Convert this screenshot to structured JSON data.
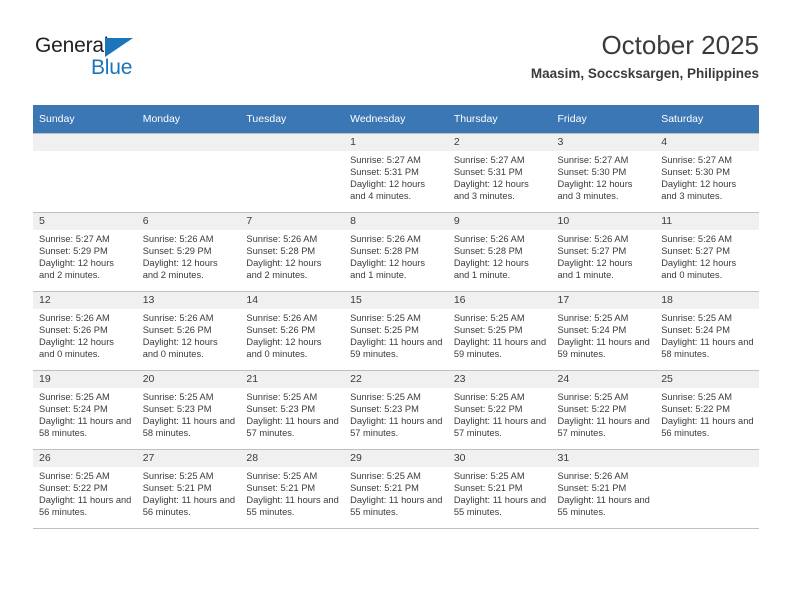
{
  "logo": {
    "word_top": "General",
    "word_bottom": "Blue",
    "triangle_icon": "triangle-icon",
    "accent_color": "#1b75bb"
  },
  "header": {
    "title": "October 2025",
    "subtitle": "Maasim, Soccsksargen, Philippines"
  },
  "theme": {
    "header_row_color": "#3b77b5",
    "daynum_bg": "#f0f0f0",
    "grid_line": "#bfbfbf",
    "text_color": "#3b3b3b"
  },
  "weekdays": [
    "Sunday",
    "Monday",
    "Tuesday",
    "Wednesday",
    "Thursday",
    "Friday",
    "Saturday"
  ],
  "weeks": [
    [
      {
        "day": "",
        "empty": true
      },
      {
        "day": "",
        "empty": true
      },
      {
        "day": "",
        "empty": true
      },
      {
        "day": "1",
        "sunrise": "Sunrise: 5:27 AM",
        "sunset": "Sunset: 5:31 PM",
        "daylight": "Daylight: 12 hours and 4 minutes."
      },
      {
        "day": "2",
        "sunrise": "Sunrise: 5:27 AM",
        "sunset": "Sunset: 5:31 PM",
        "daylight": "Daylight: 12 hours and 3 minutes."
      },
      {
        "day": "3",
        "sunrise": "Sunrise: 5:27 AM",
        "sunset": "Sunset: 5:30 PM",
        "daylight": "Daylight: 12 hours and 3 minutes."
      },
      {
        "day": "4",
        "sunrise": "Sunrise: 5:27 AM",
        "sunset": "Sunset: 5:30 PM",
        "daylight": "Daylight: 12 hours and 3 minutes."
      }
    ],
    [
      {
        "day": "5",
        "sunrise": "Sunrise: 5:27 AM",
        "sunset": "Sunset: 5:29 PM",
        "daylight": "Daylight: 12 hours and 2 minutes."
      },
      {
        "day": "6",
        "sunrise": "Sunrise: 5:26 AM",
        "sunset": "Sunset: 5:29 PM",
        "daylight": "Daylight: 12 hours and 2 minutes."
      },
      {
        "day": "7",
        "sunrise": "Sunrise: 5:26 AM",
        "sunset": "Sunset: 5:28 PM",
        "daylight": "Daylight: 12 hours and 2 minutes."
      },
      {
        "day": "8",
        "sunrise": "Sunrise: 5:26 AM",
        "sunset": "Sunset: 5:28 PM",
        "daylight": "Daylight: 12 hours and 1 minute."
      },
      {
        "day": "9",
        "sunrise": "Sunrise: 5:26 AM",
        "sunset": "Sunset: 5:28 PM",
        "daylight": "Daylight: 12 hours and 1 minute."
      },
      {
        "day": "10",
        "sunrise": "Sunrise: 5:26 AM",
        "sunset": "Sunset: 5:27 PM",
        "daylight": "Daylight: 12 hours and 1 minute."
      },
      {
        "day": "11",
        "sunrise": "Sunrise: 5:26 AM",
        "sunset": "Sunset: 5:27 PM",
        "daylight": "Daylight: 12 hours and 0 minutes."
      }
    ],
    [
      {
        "day": "12",
        "sunrise": "Sunrise: 5:26 AM",
        "sunset": "Sunset: 5:26 PM",
        "daylight": "Daylight: 12 hours and 0 minutes."
      },
      {
        "day": "13",
        "sunrise": "Sunrise: 5:26 AM",
        "sunset": "Sunset: 5:26 PM",
        "daylight": "Daylight: 12 hours and 0 minutes."
      },
      {
        "day": "14",
        "sunrise": "Sunrise: 5:26 AM",
        "sunset": "Sunset: 5:26 PM",
        "daylight": "Daylight: 12 hours and 0 minutes."
      },
      {
        "day": "15",
        "sunrise": "Sunrise: 5:25 AM",
        "sunset": "Sunset: 5:25 PM",
        "daylight": "Daylight: 11 hours and 59 minutes."
      },
      {
        "day": "16",
        "sunrise": "Sunrise: 5:25 AM",
        "sunset": "Sunset: 5:25 PM",
        "daylight": "Daylight: 11 hours and 59 minutes."
      },
      {
        "day": "17",
        "sunrise": "Sunrise: 5:25 AM",
        "sunset": "Sunset: 5:24 PM",
        "daylight": "Daylight: 11 hours and 59 minutes."
      },
      {
        "day": "18",
        "sunrise": "Sunrise: 5:25 AM",
        "sunset": "Sunset: 5:24 PM",
        "daylight": "Daylight: 11 hours and 58 minutes."
      }
    ],
    [
      {
        "day": "19",
        "sunrise": "Sunrise: 5:25 AM",
        "sunset": "Sunset: 5:24 PM",
        "daylight": "Daylight: 11 hours and 58 minutes."
      },
      {
        "day": "20",
        "sunrise": "Sunrise: 5:25 AM",
        "sunset": "Sunset: 5:23 PM",
        "daylight": "Daylight: 11 hours and 58 minutes."
      },
      {
        "day": "21",
        "sunrise": "Sunrise: 5:25 AM",
        "sunset": "Sunset: 5:23 PM",
        "daylight": "Daylight: 11 hours and 57 minutes."
      },
      {
        "day": "22",
        "sunrise": "Sunrise: 5:25 AM",
        "sunset": "Sunset: 5:23 PM",
        "daylight": "Daylight: 11 hours and 57 minutes."
      },
      {
        "day": "23",
        "sunrise": "Sunrise: 5:25 AM",
        "sunset": "Sunset: 5:22 PM",
        "daylight": "Daylight: 11 hours and 57 minutes."
      },
      {
        "day": "24",
        "sunrise": "Sunrise: 5:25 AM",
        "sunset": "Sunset: 5:22 PM",
        "daylight": "Daylight: 11 hours and 57 minutes."
      },
      {
        "day": "25",
        "sunrise": "Sunrise: 5:25 AM",
        "sunset": "Sunset: 5:22 PM",
        "daylight": "Daylight: 11 hours and 56 minutes."
      }
    ],
    [
      {
        "day": "26",
        "sunrise": "Sunrise: 5:25 AM",
        "sunset": "Sunset: 5:22 PM",
        "daylight": "Daylight: 11 hours and 56 minutes."
      },
      {
        "day": "27",
        "sunrise": "Sunrise: 5:25 AM",
        "sunset": "Sunset: 5:21 PM",
        "daylight": "Daylight: 11 hours and 56 minutes."
      },
      {
        "day": "28",
        "sunrise": "Sunrise: 5:25 AM",
        "sunset": "Sunset: 5:21 PM",
        "daylight": "Daylight: 11 hours and 55 minutes."
      },
      {
        "day": "29",
        "sunrise": "Sunrise: 5:25 AM",
        "sunset": "Sunset: 5:21 PM",
        "daylight": "Daylight: 11 hours and 55 minutes."
      },
      {
        "day": "30",
        "sunrise": "Sunrise: 5:25 AM",
        "sunset": "Sunset: 5:21 PM",
        "daylight": "Daylight: 11 hours and 55 minutes."
      },
      {
        "day": "31",
        "sunrise": "Sunrise: 5:26 AM",
        "sunset": "Sunset: 5:21 PM",
        "daylight": "Daylight: 11 hours and 55 minutes."
      },
      {
        "day": "",
        "empty": true
      }
    ]
  ]
}
